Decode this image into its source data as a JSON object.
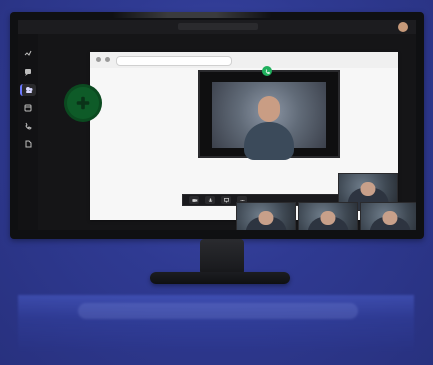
{
  "teams": {
    "search_placeholder": "",
    "rail": [
      {
        "icon": "activity-icon"
      },
      {
        "icon": "chat-icon"
      },
      {
        "icon": "teams-icon"
      },
      {
        "icon": "calendar-icon"
      },
      {
        "icon": "calls-icon"
      },
      {
        "icon": "files-icon"
      }
    ]
  },
  "browser": {
    "address": ""
  },
  "colors": {
    "background": "#2f3a92",
    "teams_accent": "#6b78ff",
    "call_green": "#20b05d",
    "leave_red": "#d33b3b",
    "teams_circle": "#0e5b28"
  }
}
